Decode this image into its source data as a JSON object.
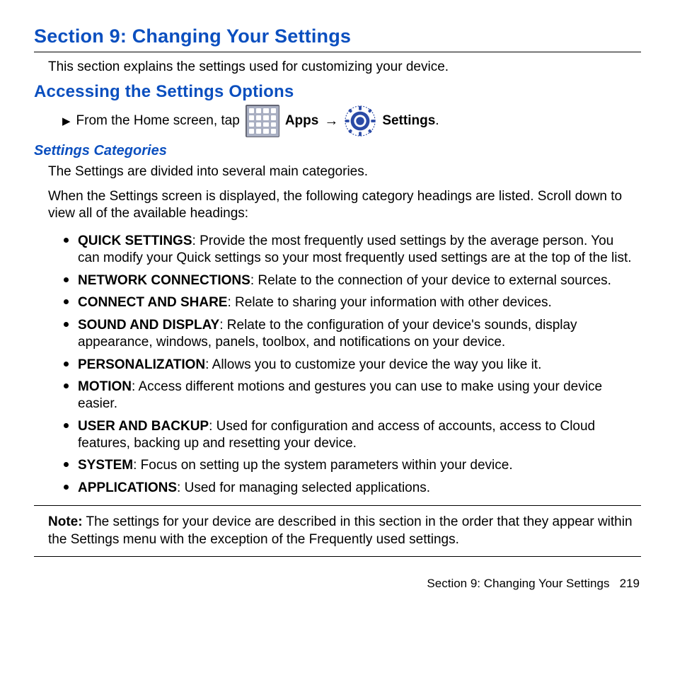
{
  "title": "Section 9: Changing Your Settings",
  "intro": "This section explains the settings used for customizing your device.",
  "accessing": {
    "heading": "Accessing the Settings Options",
    "bullet": "▶",
    "lead": "From the Home screen, tap",
    "apps_label": "Apps",
    "arrow": "→",
    "settings_label": "Settings",
    "period": "."
  },
  "categories": {
    "heading": "Settings Categories",
    "p1": "The Settings are divided into several main categories.",
    "p2": "When the Settings screen is displayed, the following category headings are listed. Scroll down to view all of the available headings:",
    "items": [
      {
        "name": "QUICK SETTINGS",
        "desc": ": Provide the most frequently used settings by the average person. You can modify your Quick settings so your most frequently used settings are at the top of the list."
      },
      {
        "name": "NETWORK CONNECTIONS",
        "desc": ": Relate to the connection of your device to external sources."
      },
      {
        "name": "CONNECT AND SHARE",
        "desc": ": Relate to sharing your information with other devices."
      },
      {
        "name": "SOUND AND DISPLAY",
        "desc": ": Relate to the configuration of your device's sounds, display appearance, windows, panels, toolbox, and notifications on your device."
      },
      {
        "name": "PERSONALIZATION",
        "desc": ": Allows you to customize your device the way you like it."
      },
      {
        "name": "MOTION",
        "desc": ": Access different motions and gestures you can use to make using your device easier."
      },
      {
        "name": "USER AND BACKUP",
        "desc": ": Used for configuration and access of accounts, access to Cloud features, backing up and resetting your device."
      },
      {
        "name": "SYSTEM",
        "desc": ": Focus on setting up the system parameters within your device."
      },
      {
        "name": "APPLICATIONS",
        "desc": ": Used for managing selected applications."
      }
    ]
  },
  "note": {
    "label": "Note:",
    "body": "The settings for your device are described in this section in the order that they appear within the Settings menu with the exception of the Frequently used settings."
  },
  "footer": {
    "section": "Section 9:  Changing Your Settings",
    "page": "219"
  }
}
